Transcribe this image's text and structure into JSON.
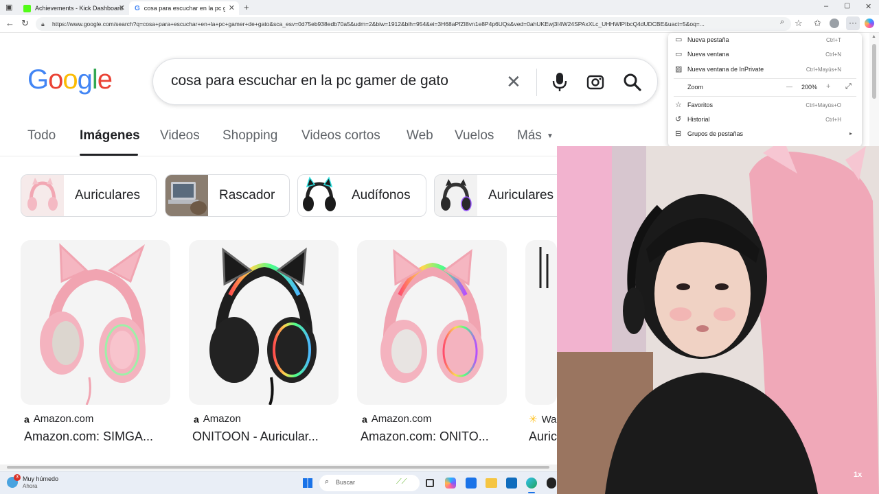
{
  "browser": {
    "tabs": [
      {
        "title": "Achievements - Kick Dashboard"
      },
      {
        "title": "cosa para escuchar en la pc gamer de gato"
      }
    ],
    "url": "https://www.google.com/search?q=cosa+para+escuchar+en+la+pc+gamer+de+gato&sca_esv=0d75eb938edb70a5&udm=2&biw=1912&bih=954&ei=3H68aPfZI8vn1e8P4p6UQs&ved=0ahUKEwj3I4W24SPAxXLc_UHHWlPIbcQ4dUDCBE&uact=5&oq=..."
  },
  "search": {
    "query": "cosa para escuchar en la pc gamer de gato"
  },
  "nav_tabs": [
    "Todo",
    "Imágenes",
    "Videos",
    "Shopping",
    "Videos cortos",
    "Web",
    "Vuelos",
    "Más"
  ],
  "chips": [
    "Auriculares",
    "Rascador",
    "Audífonos",
    "Auriculares"
  ],
  "results": [
    {
      "source": "Amazon.com",
      "title": "Amazon.com: SIMGA..."
    },
    {
      "source": "Amazon",
      "title": "ONITOON - Auricular..."
    },
    {
      "source": "Amazon.com",
      "title": "Amazon.com: ONITO..."
    },
    {
      "source": "Wa",
      "title": "Auric"
    }
  ],
  "menu": {
    "items": [
      {
        "label": "Nueva pestaña",
        "shortcut": "Ctrl+T"
      },
      {
        "label": "Nueva ventana",
        "shortcut": "Ctrl+N"
      },
      {
        "label": "Nueva ventana de InPrivate",
        "shortcut": "Ctrl+Mayús+N"
      },
      {
        "label": "Zoom",
        "shortcut": ""
      },
      {
        "label": "Favoritos",
        "shortcut": "Ctrl+Mayús+O"
      },
      {
        "label": "Historial",
        "shortcut": "Ctrl+H"
      },
      {
        "label": "Grupos de pestañas",
        "shortcut": ""
      }
    ],
    "zoom_value": "200%",
    "zoom_minus": "—",
    "zoom_plus": "+"
  },
  "taskbar": {
    "weather_title": "Muy húmedo",
    "weather_sub": "Ahora",
    "weather_badge": "3",
    "search_placeholder": "Buscar"
  },
  "webcam": {
    "speed_label": "1x"
  },
  "colors": {
    "google_blue": "#4285F4",
    "google_red": "#EA4335",
    "google_yellow": "#FBBC05",
    "google_green": "#34A853"
  }
}
